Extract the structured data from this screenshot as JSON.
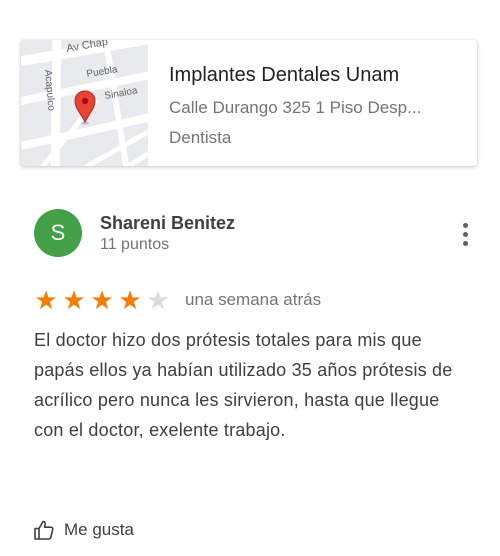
{
  "place": {
    "name": "Implantes Dentales Unam",
    "address": "Calle Durango 325 1 Piso Desp...",
    "category": "Dentista",
    "map_labels": {
      "street_top": "Av Chap",
      "street_puebla": "Puebla",
      "street_sinaloa": "Sinaloa",
      "street_acapulco": "Acapulco"
    }
  },
  "review": {
    "avatar_initial": "S",
    "reviewer_name": "Shareni Benitez",
    "reviewer_points": "11 puntos",
    "rating": 4,
    "rating_max": 5,
    "date": "una semana atrás",
    "text": "El doctor hizo dos prótesis totales para mis que papás ellos ya habían utilizado 35 años prótesis de acrílico pero nunca les sirvieron, hasta que llegue con el doctor, exelente trabajo.",
    "like_label": "Me gusta"
  },
  "colors": {
    "star_filled": "#f57c00",
    "star_empty": "#dadce0",
    "avatar_bg": "#43a047",
    "pin": "#ea4335"
  },
  "icons": {
    "more": "more-vert-icon",
    "like": "thumb-up-icon",
    "pin": "map-pin-icon"
  }
}
